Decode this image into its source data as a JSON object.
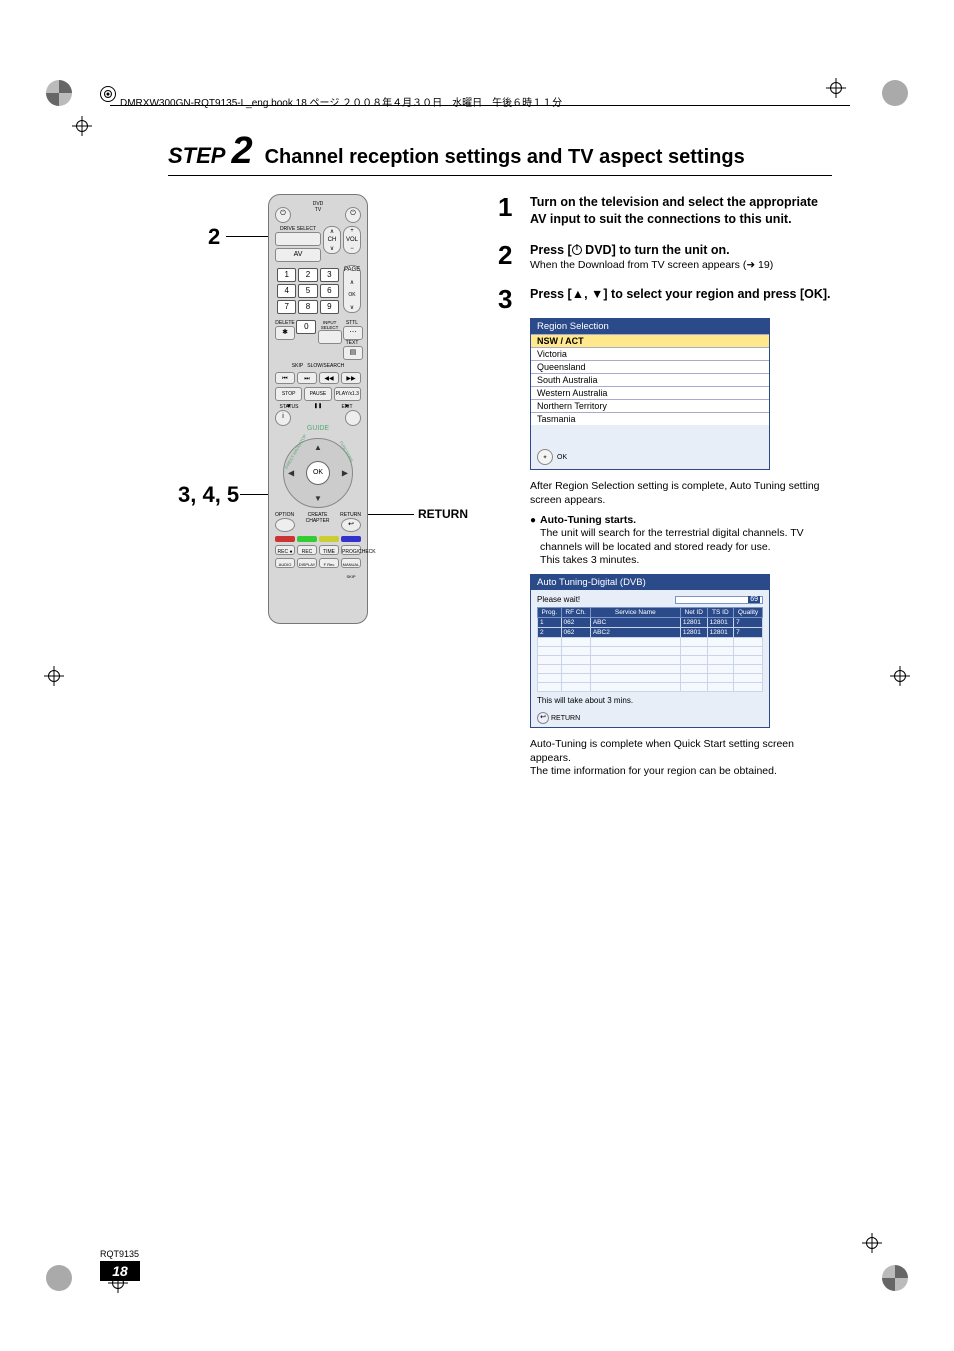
{
  "header_line": "DMRXW300GN-RQT9135-L_eng.book  18 ページ  ２００８年４月３０日　水曜日　午後６時１１分",
  "title": {
    "step_word": "STEP",
    "step_number": "2",
    "heading": "Channel reception settings and TV aspect settings"
  },
  "remote": {
    "top_labels": {
      "dvd": "DVD",
      "tv": "TV",
      "page": "PAGE",
      "ch": "CH",
      "vol": "VOL",
      "av": "AV",
      "drive_select": "DRIVE SELECT"
    },
    "numbers": [
      "1",
      "2",
      "3",
      "4",
      "5",
      "6",
      "7",
      "8",
      "9",
      "0"
    ],
    "delete": "DELETE",
    "input_select": "INPUT SELECT",
    "sttl": "STTL",
    "text": "TEXT",
    "skip": "SKIP",
    "slow_search": "SLOW/SEARCH",
    "stop": "STOP",
    "pause": "PAUSE",
    "play": "PLAY/x1.3",
    "status": "STATUS",
    "exit": "EXIT",
    "guide": "GUIDE",
    "ok": "OK",
    "option": "OPTION",
    "return_lbl": "RETURN",
    "create_chapter": "CREATE CHAPTER",
    "rec": "REC",
    "rec_mode": "REC MODE",
    "time_slip": "TIME SLIP",
    "prog_check": "PROG/CHECK",
    "audio": "AUDIO",
    "display": "DISPLAY",
    "frec": "F Rec",
    "manual_skip": "MANUAL SKIP",
    "direct_navigator": "DIRECT NAVIGATOR",
    "functions": "FUNCTIONS"
  },
  "callouts": {
    "top": "2",
    "mid": "3, 4, 5",
    "return": "RETURN"
  },
  "steps": {
    "s1": "Turn on the television and select the appropriate AV input to suit the connections to this unit.",
    "s2": "Press [",
    "s2b": " DVD] to turn the unit on.",
    "s2_note": "When the Download from TV screen appears (",
    "s2_ref": " 19)",
    "s3a": "Press [",
    "s3_arrows_up": "▲",
    "s3_sep": ", ",
    "s3_arrows_dn": "▼",
    "s3b": "] to select your region and press [OK]."
  },
  "region_panel": {
    "title": "Region Selection",
    "items": [
      "NSW / ACT",
      "Victoria",
      "Queensland",
      "South Australia",
      "Western Australia",
      "Northern Territory",
      "Tasmania"
    ],
    "ok": "OK"
  },
  "after_region": "After Region Selection setting is complete, Auto Tuning setting screen appears.",
  "auto_head": "Auto-Tuning starts.",
  "auto_body": "The unit will search for the terrestrial digital channels. TV channels will be located and stored ready for use.\nThis takes 3 minutes.",
  "tuning_panel": {
    "title": "Auto Tuning-Digital (DVB)",
    "please_wait": "Please wait!",
    "progress_pct": 6,
    "ch_right": "69",
    "columns": [
      "Prog.",
      "RF Ch.",
      "Service Name",
      "Net ID",
      "TS ID",
      "Quality"
    ],
    "rows": [
      {
        "prog": "1",
        "rf": "062",
        "name": "ABC",
        "net": "12801",
        "ts": "12801",
        "q": "7"
      },
      {
        "prog": "2",
        "rf": "062",
        "name": "ABC2",
        "net": "12801",
        "ts": "12801",
        "q": "7"
      }
    ],
    "empty_rows": 6,
    "note": "This will take about 3 mins.",
    "return": "RETURN"
  },
  "post_tune_1": "Auto-Tuning is complete when Quick Start setting screen appears.",
  "post_tune_2": "The time information for your region can be obtained.",
  "footer": {
    "rqt": "RQT9135",
    "page": "18"
  }
}
